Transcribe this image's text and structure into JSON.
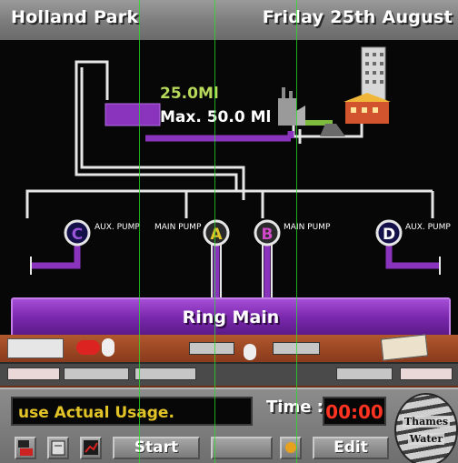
{
  "header": {
    "location": "Holland Park",
    "date": "Friday 25th August"
  },
  "reservoir": {
    "level": "25.0Ml",
    "max": "Max. 50.0 Ml",
    "fill_fraction": 0.5
  },
  "pumps": [
    {
      "id": "C",
      "label": "AUX. PUMP",
      "color": "#7a28ad"
    },
    {
      "id": "A",
      "label": "MAIN PUMP",
      "color": "#e3c428"
    },
    {
      "id": "B",
      "label": "MAIN PUMP",
      "color": "#cf49c9"
    },
    {
      "id": "D",
      "label": "AUX. PUMP",
      "color": "#ffffff"
    }
  ],
  "ring_main": {
    "label": "Ring Main",
    "color": "#8a34be"
  },
  "panel": {
    "message": "use Actual Usage.",
    "time_label": "Time :",
    "time_value": "00:00",
    "start_label": "Start",
    "edit_label": "Edit",
    "logo_line1": "Thames",
    "logo_line2": "Water"
  },
  "icons": [
    "network-icon",
    "pump-icon",
    "graph-icon",
    "sun-icon",
    "fax-icon",
    "newspaper-icon"
  ]
}
